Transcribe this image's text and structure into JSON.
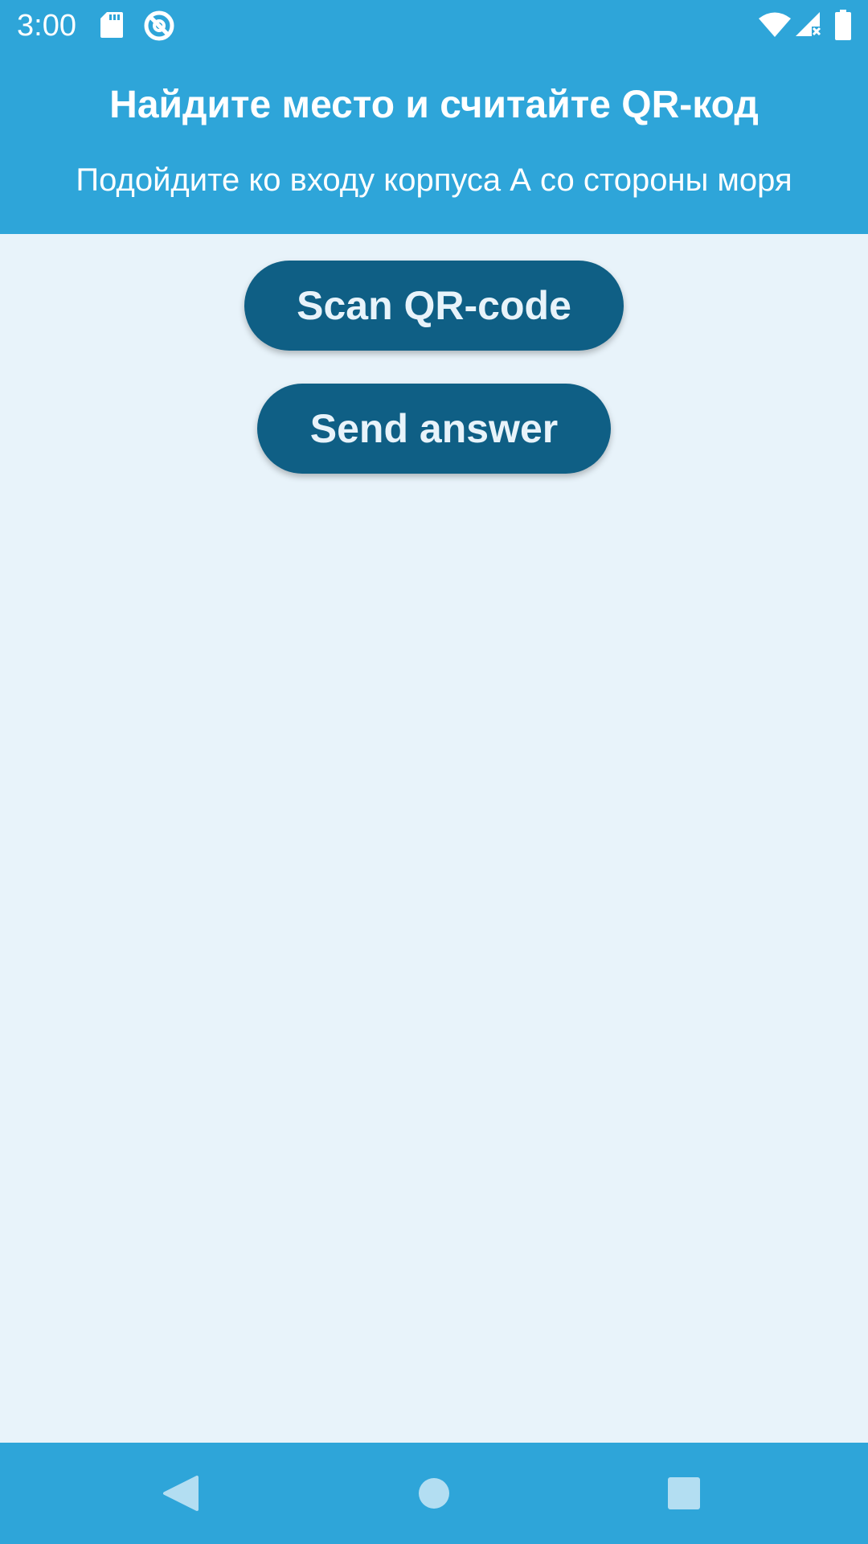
{
  "status_bar": {
    "time": "3:00",
    "icons": [
      "sd-card-icon",
      "no-disturb-icon",
      "wifi-icon",
      "signal-no-data-icon",
      "battery-icon"
    ]
  },
  "header": {
    "title": "Найдите место и считайте QR-код",
    "subtitle": "Подойдите ко входу корпуса А со стороны моря"
  },
  "buttons": {
    "scan_label": "Scan QR-code",
    "send_label": "Send answer"
  },
  "nav_bar": {
    "icons": [
      "back-icon",
      "home-icon",
      "recents-icon"
    ]
  },
  "colors": {
    "primary": "#2ea5d9",
    "button": "#0f5f85",
    "background": "#e8f3fa",
    "nav_icon": "#b3def2"
  }
}
